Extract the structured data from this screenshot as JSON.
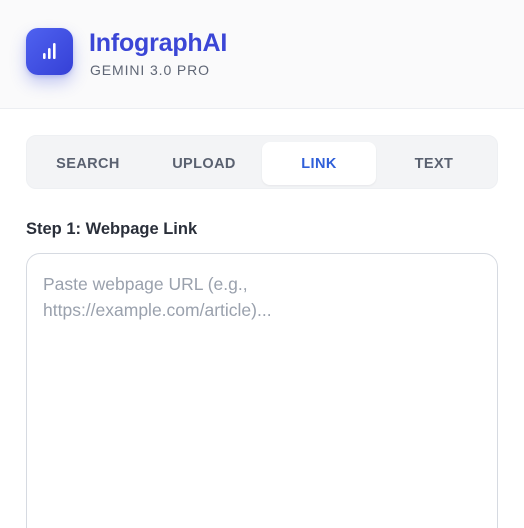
{
  "header": {
    "logo_icon": "bar-chart-icon",
    "title": "InfographAI",
    "subtitle": "GEMINI 3.0 PRO"
  },
  "tabs": [
    {
      "label": "SEARCH",
      "active": false
    },
    {
      "label": "UPLOAD",
      "active": false
    },
    {
      "label": "LINK",
      "active": true
    },
    {
      "label": "TEXT",
      "active": false
    }
  ],
  "step": {
    "label": "Step 1: Webpage Link"
  },
  "url_input": {
    "value": "",
    "placeholder": "Paste webpage URL (e.g., https://example.com/article)..."
  },
  "colors": {
    "brand": "#3b46d6",
    "active_tab_text": "#2f5fd9",
    "tab_bar_bg": "#f3f4f6"
  }
}
